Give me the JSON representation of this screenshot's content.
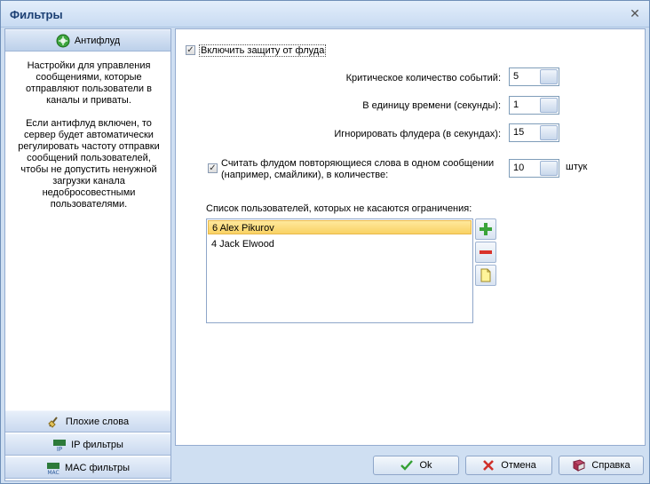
{
  "window": {
    "title": "Фильтры"
  },
  "nav": {
    "antiflood": "Антифлуд",
    "bad_words": "Плохие слова",
    "ip_filters": "IP фильтры",
    "mac_filters": "MAC фильтры"
  },
  "description": {
    "p1": "Настройки для управления сообщениями, которые отправляют пользователи в каналы и приваты.",
    "p2": "Если антифлуд включен, то сервер будет автоматически регулировать частоту отправки сообщений пользователей, чтобы не допустить ненужной загрузки канала недобросовестными пользователями."
  },
  "settings": {
    "enable_label": "Включить защиту от флуда",
    "enable_checked": true,
    "critical_label": "Критическое количество событий:",
    "critical_value": "5",
    "period_label": "В единицу времени (секунды):",
    "period_value": "1",
    "ignore_label": "Игнорировать флудера (в секундах):",
    "ignore_value": "15",
    "repeat_label_1": "Считать флудом повторяющиеся слова в одном сообщении",
    "repeat_label_2": "(например, смайлики), в количестве:",
    "repeat_checked": true,
    "repeat_value": "10",
    "repeat_unit": "штук"
  },
  "exempt": {
    "label": "Список пользователей, которых не касаются ограничения:",
    "users": [
      "6 Alex Pikurov",
      "4 Jack Elwood"
    ]
  },
  "buttons": {
    "ok": "Ok",
    "cancel": "Отмена",
    "help": "Справка"
  },
  "colors": {
    "accent": "#1b3f73",
    "selection": "#f9d264"
  }
}
